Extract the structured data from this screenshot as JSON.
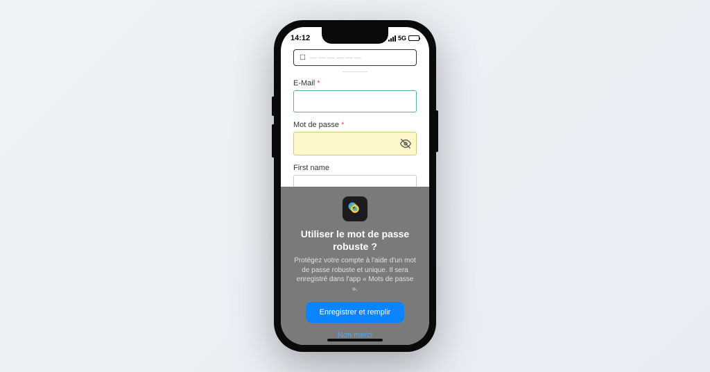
{
  "status": {
    "time": "14:12",
    "network": "5G"
  },
  "form": {
    "email_label": "E-Mail",
    "password_label": "Mot de passe",
    "firstname_label": "First name",
    "required_mark": "*"
  },
  "sheet": {
    "title": "Utiliser le mot de passe robuste ?",
    "description": "Protégez votre compte à l'aide d'un mot de passe robuste et unique. Il sera enregistré dans l'app « Mots de passe ».",
    "primary_button": "Enregistrer et remplir",
    "secondary_button": "Non merci"
  }
}
